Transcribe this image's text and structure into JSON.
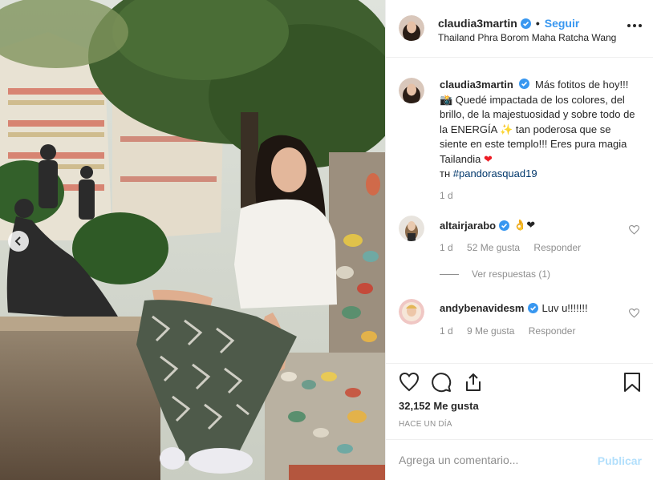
{
  "post": {
    "username": "claudia3martin",
    "follow_label": "Seguir",
    "location": "Thailand Phra Borom Maha Ratcha Wang",
    "more_icon": "more-horizontal-icon",
    "photo_alt": "claudia3martin photo"
  },
  "caption": {
    "username": "claudia3martin",
    "text_1": "Más fotitos de hoy!!! 📸 Quedé impactada de los colores, del brillo, de la majestuosidad y sobre todo de la ENERGÍA ✨ tan poderosa que se siente en este templo!!! Eres pura magia Tailandia",
    "text_2": "ᴛʜ",
    "hashtag": "#pandorasquad19",
    "time": "1 d"
  },
  "comments": [
    {
      "username": "altairjarabo",
      "text": "👌❤",
      "time": "1 d",
      "likes": "52 Me gusta",
      "reply": "Responder"
    },
    {
      "username": "andybenavidesm",
      "text": "Luv u!!!!!!!",
      "time": "1 d",
      "likes": "9 Me gusta",
      "reply": "Responder"
    }
  ],
  "view_replies": "Ver respuestas (1)",
  "actions": {
    "likes": "32,152 Me gusta",
    "time_ago": "HACE UN DÍA"
  },
  "add_comment": {
    "placeholder": "Agrega un comentario...",
    "publish_label": "Publicar"
  },
  "colors": {
    "link_blue": "#3897f0",
    "publish_disabled": "#b2dffc",
    "hashtag": "#00376b",
    "verified": "#3897f0",
    "secondary_text": "#8e8e8e"
  }
}
